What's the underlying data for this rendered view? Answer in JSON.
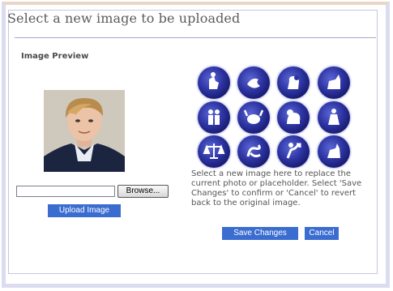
{
  "header": {
    "title": "Select a new image to be uploaded"
  },
  "preview": {
    "label": "Image Preview"
  },
  "upload_form": {
    "file_value": "",
    "browse_label": "Browse...",
    "upload_label": "Upload Image"
  },
  "zodiac_icons": [
    "aquarius-icon",
    "pisces-icon",
    "aries-icon",
    "taurus-icon",
    "gemini-icon",
    "cancer-icon",
    "leo-icon",
    "virgo-icon",
    "libra-icon",
    "scorpio-icon",
    "sagittarius-icon",
    "capricorn-icon"
  ],
  "instructions": "Select a new image here to replace the current photo or placeholder. Select 'Save Changes' to confirm or 'Cancel' to revert back to the original image.",
  "actions": {
    "save_label": "Save Changes",
    "cancel_label": "Cancel"
  },
  "colors": {
    "button_blue": "#3b6dd1",
    "orb_dark": "#141766",
    "orb_light": "#5a66d6"
  }
}
